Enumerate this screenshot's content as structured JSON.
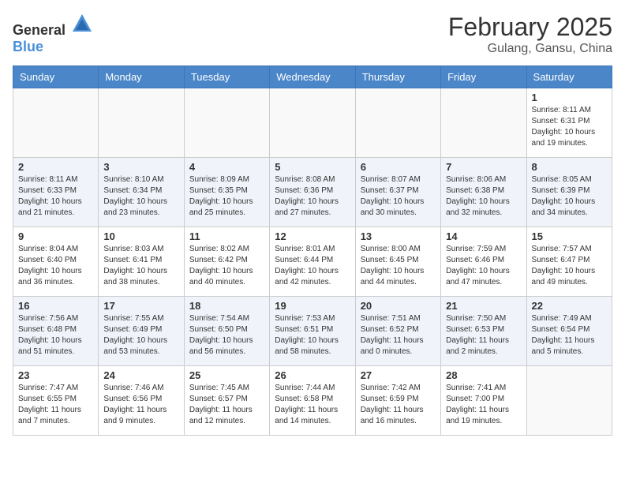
{
  "logo": {
    "general": "General",
    "blue": "Blue"
  },
  "header": {
    "month": "February 2025",
    "location": "Gulang, Gansu, China"
  },
  "days_of_week": [
    "Sunday",
    "Monday",
    "Tuesday",
    "Wednesday",
    "Thursday",
    "Friday",
    "Saturday"
  ],
  "weeks": [
    [
      {
        "day": "",
        "info": ""
      },
      {
        "day": "",
        "info": ""
      },
      {
        "day": "",
        "info": ""
      },
      {
        "day": "",
        "info": ""
      },
      {
        "day": "",
        "info": ""
      },
      {
        "day": "",
        "info": ""
      },
      {
        "day": "1",
        "info": "Sunrise: 8:11 AM\nSunset: 6:31 PM\nDaylight: 10 hours\nand 19 minutes."
      }
    ],
    [
      {
        "day": "2",
        "info": "Sunrise: 8:11 AM\nSunset: 6:33 PM\nDaylight: 10 hours\nand 21 minutes."
      },
      {
        "day": "3",
        "info": "Sunrise: 8:10 AM\nSunset: 6:34 PM\nDaylight: 10 hours\nand 23 minutes."
      },
      {
        "day": "4",
        "info": "Sunrise: 8:09 AM\nSunset: 6:35 PM\nDaylight: 10 hours\nand 25 minutes."
      },
      {
        "day": "5",
        "info": "Sunrise: 8:08 AM\nSunset: 6:36 PM\nDaylight: 10 hours\nand 27 minutes."
      },
      {
        "day": "6",
        "info": "Sunrise: 8:07 AM\nSunset: 6:37 PM\nDaylight: 10 hours\nand 30 minutes."
      },
      {
        "day": "7",
        "info": "Sunrise: 8:06 AM\nSunset: 6:38 PM\nDaylight: 10 hours\nand 32 minutes."
      },
      {
        "day": "8",
        "info": "Sunrise: 8:05 AM\nSunset: 6:39 PM\nDaylight: 10 hours\nand 34 minutes."
      }
    ],
    [
      {
        "day": "9",
        "info": "Sunrise: 8:04 AM\nSunset: 6:40 PM\nDaylight: 10 hours\nand 36 minutes."
      },
      {
        "day": "10",
        "info": "Sunrise: 8:03 AM\nSunset: 6:41 PM\nDaylight: 10 hours\nand 38 minutes."
      },
      {
        "day": "11",
        "info": "Sunrise: 8:02 AM\nSunset: 6:42 PM\nDaylight: 10 hours\nand 40 minutes."
      },
      {
        "day": "12",
        "info": "Sunrise: 8:01 AM\nSunset: 6:44 PM\nDaylight: 10 hours\nand 42 minutes."
      },
      {
        "day": "13",
        "info": "Sunrise: 8:00 AM\nSunset: 6:45 PM\nDaylight: 10 hours\nand 44 minutes."
      },
      {
        "day": "14",
        "info": "Sunrise: 7:59 AM\nSunset: 6:46 PM\nDaylight: 10 hours\nand 47 minutes."
      },
      {
        "day": "15",
        "info": "Sunrise: 7:57 AM\nSunset: 6:47 PM\nDaylight: 10 hours\nand 49 minutes."
      }
    ],
    [
      {
        "day": "16",
        "info": "Sunrise: 7:56 AM\nSunset: 6:48 PM\nDaylight: 10 hours\nand 51 minutes."
      },
      {
        "day": "17",
        "info": "Sunrise: 7:55 AM\nSunset: 6:49 PM\nDaylight: 10 hours\nand 53 minutes."
      },
      {
        "day": "18",
        "info": "Sunrise: 7:54 AM\nSunset: 6:50 PM\nDaylight: 10 hours\nand 56 minutes."
      },
      {
        "day": "19",
        "info": "Sunrise: 7:53 AM\nSunset: 6:51 PM\nDaylight: 10 hours\nand 58 minutes."
      },
      {
        "day": "20",
        "info": "Sunrise: 7:51 AM\nSunset: 6:52 PM\nDaylight: 11 hours\nand 0 minutes."
      },
      {
        "day": "21",
        "info": "Sunrise: 7:50 AM\nSunset: 6:53 PM\nDaylight: 11 hours\nand 2 minutes."
      },
      {
        "day": "22",
        "info": "Sunrise: 7:49 AM\nSunset: 6:54 PM\nDaylight: 11 hours\nand 5 minutes."
      }
    ],
    [
      {
        "day": "23",
        "info": "Sunrise: 7:47 AM\nSunset: 6:55 PM\nDaylight: 11 hours\nand 7 minutes."
      },
      {
        "day": "24",
        "info": "Sunrise: 7:46 AM\nSunset: 6:56 PM\nDaylight: 11 hours\nand 9 minutes."
      },
      {
        "day": "25",
        "info": "Sunrise: 7:45 AM\nSunset: 6:57 PM\nDaylight: 11 hours\nand 12 minutes."
      },
      {
        "day": "26",
        "info": "Sunrise: 7:44 AM\nSunset: 6:58 PM\nDaylight: 11 hours\nand 14 minutes."
      },
      {
        "day": "27",
        "info": "Sunrise: 7:42 AM\nSunset: 6:59 PM\nDaylight: 11 hours\nand 16 minutes."
      },
      {
        "day": "28",
        "info": "Sunrise: 7:41 AM\nSunset: 7:00 PM\nDaylight: 11 hours\nand 19 minutes."
      },
      {
        "day": "",
        "info": ""
      }
    ]
  ]
}
